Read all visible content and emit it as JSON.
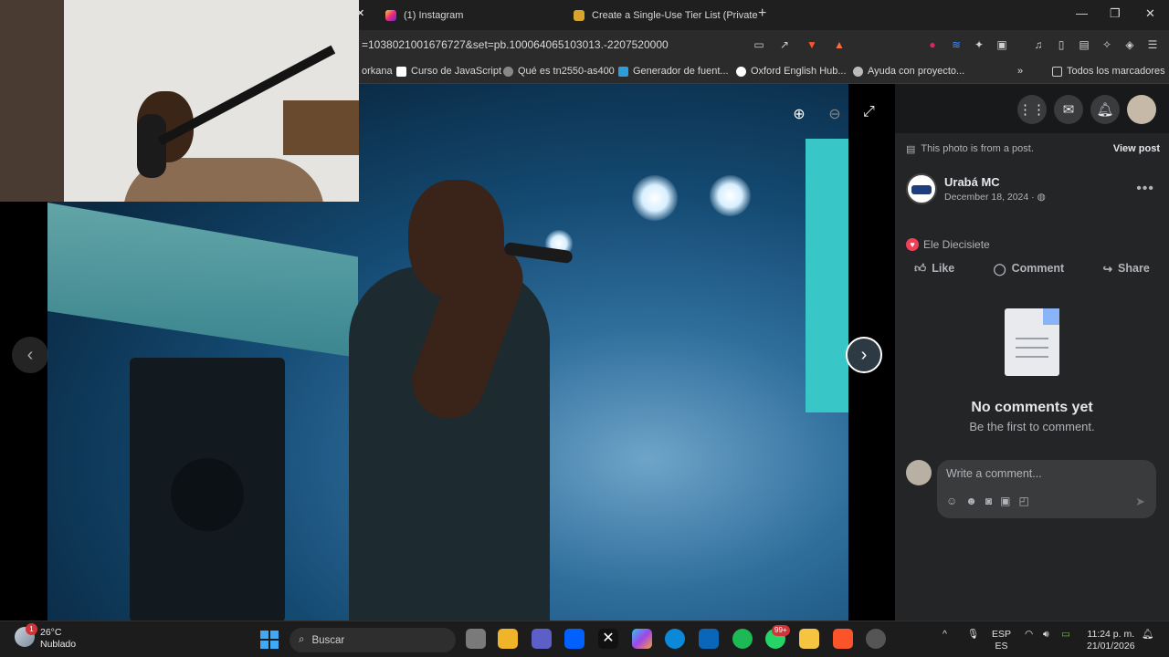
{
  "tabs": [
    {
      "label": "(1) Instagram"
    },
    {
      "label": "Create a Single-Use Tier List (Private"
    }
  ],
  "url": "=1038021001676727&set=pb.100064065103013.-2207520000",
  "bookmarks": [
    {
      "label": "orkana"
    },
    {
      "label": "Curso de JavaScript"
    },
    {
      "label": "Qué es tn2550-as400"
    },
    {
      "label": "Generador de fuent..."
    },
    {
      "label": "Oxford English Hub..."
    },
    {
      "label": "Ayuda con proyecto..."
    },
    {
      "label": "Todos los marcadores"
    }
  ],
  "post": {
    "note": "This photo is from a post.",
    "view_post": "View post",
    "author": "Urabá MC",
    "date": "December 18, 2024 ·",
    "reaction_name": "Ele Diecisiete",
    "like": "Like",
    "comment": "Comment",
    "share": "Share",
    "empty_title": "No comments yet",
    "empty_sub": "Be the first to comment.",
    "comment_placeholder": "Write a comment..."
  },
  "taskbar": {
    "temperature": "26°C",
    "weather": "Nublado",
    "weather_badge": "1",
    "search": "Buscar",
    "whatsapp_badge": "99+",
    "lang1": "ESP",
    "lang2": "ES",
    "time": "11:24 p. m.",
    "date": "21/01/2026"
  },
  "colors": {
    "fb_panel": "#242526",
    "fb_text": "#e4e6eb",
    "heart": "#f33e58",
    "taskbar": "#1c1c1c"
  }
}
